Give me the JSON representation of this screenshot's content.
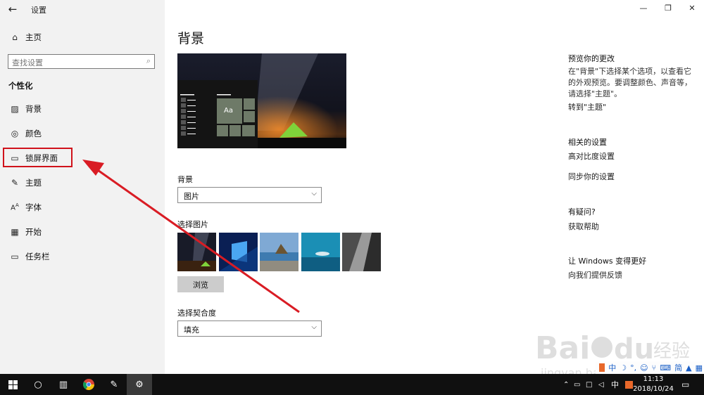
{
  "app": {
    "title": "设置",
    "back_icon": "back-arrow-icon"
  },
  "sidebar": {
    "home": "主页",
    "search_placeholder": "查找设置",
    "section": "个性化",
    "items": [
      {
        "label": "背景",
        "icon": "image-icon"
      },
      {
        "label": "颜色",
        "icon": "palette-icon"
      },
      {
        "label": "锁屏界面",
        "icon": "lock-screen-icon"
      },
      {
        "label": "主题",
        "icon": "brush-icon"
      },
      {
        "label": "字体",
        "icon": "font-icon"
      },
      {
        "label": "开始",
        "icon": "start-icon"
      },
      {
        "label": "任务栏",
        "icon": "taskbar-icon"
      }
    ]
  },
  "main": {
    "title": "背景",
    "preview_sample_text": "Aa",
    "background_label": "背景",
    "background_value": "图片",
    "choose_picture_label": "选择图片",
    "browse_label": "浏览",
    "fit_label": "选择契合度",
    "fit_value": "填充"
  },
  "right": {
    "preview_heading": "预览你的更改",
    "preview_text": "在\"背景\"下选择某个选项，以查看它的外观预览。要调整颜色、声音等，请选择\"主题\"。",
    "goto_theme": "转到\"主题\"",
    "related_heading": "相关的设置",
    "high_contrast": "高对比度设置",
    "sync": "同步你的设置",
    "question_heading": "有疑问?",
    "get_help": "获取帮助",
    "better_heading": "让 Windows 变得更好",
    "feedback": "向我们提供反馈"
  },
  "taskbar": {
    "time": "11:13",
    "date": "2018/10/24",
    "ime_lang": "中"
  },
  "ime_bar": {
    "items": [
      "中",
      "简"
    ]
  },
  "watermark": {
    "text": "Baidu经验",
    "url_text": "jingyan.baidu.com"
  },
  "colors": {
    "highlight_red": "#d0121b",
    "sidebar_bg": "#f2f2f2",
    "taskbar_bg": "#101010"
  }
}
